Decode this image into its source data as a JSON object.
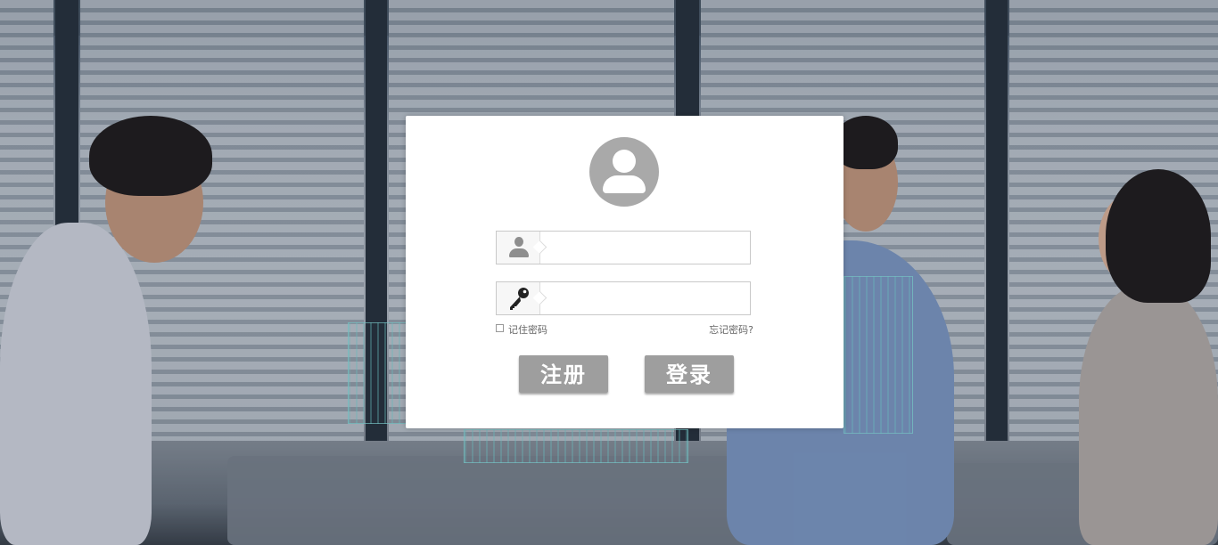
{
  "login_form": {
    "username_value": "",
    "password_value": "",
    "remember_label": "记住密码",
    "forgot_label": "忘记密码?",
    "register_label": "注册",
    "login_label": "登录",
    "remember_checked": false
  },
  "icons": {
    "avatar": "user-avatar-icon",
    "username": "user-icon",
    "password": "key-icon"
  },
  "colors": {
    "button": "#9e9e9e",
    "card": "#ffffff",
    "avatar": "#a9a9a9"
  }
}
